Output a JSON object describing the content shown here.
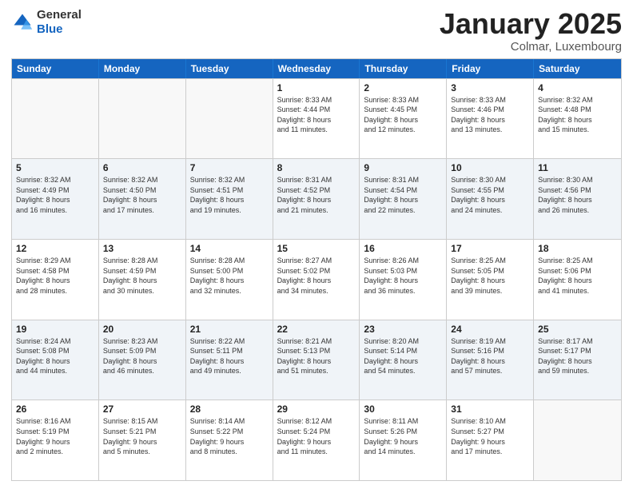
{
  "logo": {
    "general": "General",
    "blue": "Blue"
  },
  "header": {
    "title": "January 2025",
    "subtitle": "Colmar, Luxembourg"
  },
  "days": [
    "Sunday",
    "Monday",
    "Tuesday",
    "Wednesday",
    "Thursday",
    "Friday",
    "Saturday"
  ],
  "weeks": [
    [
      {
        "day": "",
        "info": ""
      },
      {
        "day": "",
        "info": ""
      },
      {
        "day": "",
        "info": ""
      },
      {
        "day": "1",
        "info": "Sunrise: 8:33 AM\nSunset: 4:44 PM\nDaylight: 8 hours\nand 11 minutes."
      },
      {
        "day": "2",
        "info": "Sunrise: 8:33 AM\nSunset: 4:45 PM\nDaylight: 8 hours\nand 12 minutes."
      },
      {
        "day": "3",
        "info": "Sunrise: 8:33 AM\nSunset: 4:46 PM\nDaylight: 8 hours\nand 13 minutes."
      },
      {
        "day": "4",
        "info": "Sunrise: 8:32 AM\nSunset: 4:48 PM\nDaylight: 8 hours\nand 15 minutes."
      }
    ],
    [
      {
        "day": "5",
        "info": "Sunrise: 8:32 AM\nSunset: 4:49 PM\nDaylight: 8 hours\nand 16 minutes."
      },
      {
        "day": "6",
        "info": "Sunrise: 8:32 AM\nSunset: 4:50 PM\nDaylight: 8 hours\nand 17 minutes."
      },
      {
        "day": "7",
        "info": "Sunrise: 8:32 AM\nSunset: 4:51 PM\nDaylight: 8 hours\nand 19 minutes."
      },
      {
        "day": "8",
        "info": "Sunrise: 8:31 AM\nSunset: 4:52 PM\nDaylight: 8 hours\nand 21 minutes."
      },
      {
        "day": "9",
        "info": "Sunrise: 8:31 AM\nSunset: 4:54 PM\nDaylight: 8 hours\nand 22 minutes."
      },
      {
        "day": "10",
        "info": "Sunrise: 8:30 AM\nSunset: 4:55 PM\nDaylight: 8 hours\nand 24 minutes."
      },
      {
        "day": "11",
        "info": "Sunrise: 8:30 AM\nSunset: 4:56 PM\nDaylight: 8 hours\nand 26 minutes."
      }
    ],
    [
      {
        "day": "12",
        "info": "Sunrise: 8:29 AM\nSunset: 4:58 PM\nDaylight: 8 hours\nand 28 minutes."
      },
      {
        "day": "13",
        "info": "Sunrise: 8:28 AM\nSunset: 4:59 PM\nDaylight: 8 hours\nand 30 minutes."
      },
      {
        "day": "14",
        "info": "Sunrise: 8:28 AM\nSunset: 5:00 PM\nDaylight: 8 hours\nand 32 minutes."
      },
      {
        "day": "15",
        "info": "Sunrise: 8:27 AM\nSunset: 5:02 PM\nDaylight: 8 hours\nand 34 minutes."
      },
      {
        "day": "16",
        "info": "Sunrise: 8:26 AM\nSunset: 5:03 PM\nDaylight: 8 hours\nand 36 minutes."
      },
      {
        "day": "17",
        "info": "Sunrise: 8:25 AM\nSunset: 5:05 PM\nDaylight: 8 hours\nand 39 minutes."
      },
      {
        "day": "18",
        "info": "Sunrise: 8:25 AM\nSunset: 5:06 PM\nDaylight: 8 hours\nand 41 minutes."
      }
    ],
    [
      {
        "day": "19",
        "info": "Sunrise: 8:24 AM\nSunset: 5:08 PM\nDaylight: 8 hours\nand 44 minutes."
      },
      {
        "day": "20",
        "info": "Sunrise: 8:23 AM\nSunset: 5:09 PM\nDaylight: 8 hours\nand 46 minutes."
      },
      {
        "day": "21",
        "info": "Sunrise: 8:22 AM\nSunset: 5:11 PM\nDaylight: 8 hours\nand 49 minutes."
      },
      {
        "day": "22",
        "info": "Sunrise: 8:21 AM\nSunset: 5:13 PM\nDaylight: 8 hours\nand 51 minutes."
      },
      {
        "day": "23",
        "info": "Sunrise: 8:20 AM\nSunset: 5:14 PM\nDaylight: 8 hours\nand 54 minutes."
      },
      {
        "day": "24",
        "info": "Sunrise: 8:19 AM\nSunset: 5:16 PM\nDaylight: 8 hours\nand 57 minutes."
      },
      {
        "day": "25",
        "info": "Sunrise: 8:17 AM\nSunset: 5:17 PM\nDaylight: 8 hours\nand 59 minutes."
      }
    ],
    [
      {
        "day": "26",
        "info": "Sunrise: 8:16 AM\nSunset: 5:19 PM\nDaylight: 9 hours\nand 2 minutes."
      },
      {
        "day": "27",
        "info": "Sunrise: 8:15 AM\nSunset: 5:21 PM\nDaylight: 9 hours\nand 5 minutes."
      },
      {
        "day": "28",
        "info": "Sunrise: 8:14 AM\nSunset: 5:22 PM\nDaylight: 9 hours\nand 8 minutes."
      },
      {
        "day": "29",
        "info": "Sunrise: 8:12 AM\nSunset: 5:24 PM\nDaylight: 9 hours\nand 11 minutes."
      },
      {
        "day": "30",
        "info": "Sunrise: 8:11 AM\nSunset: 5:26 PM\nDaylight: 9 hours\nand 14 minutes."
      },
      {
        "day": "31",
        "info": "Sunrise: 8:10 AM\nSunset: 5:27 PM\nDaylight: 9 hours\nand 17 minutes."
      },
      {
        "day": "",
        "info": ""
      }
    ]
  ]
}
